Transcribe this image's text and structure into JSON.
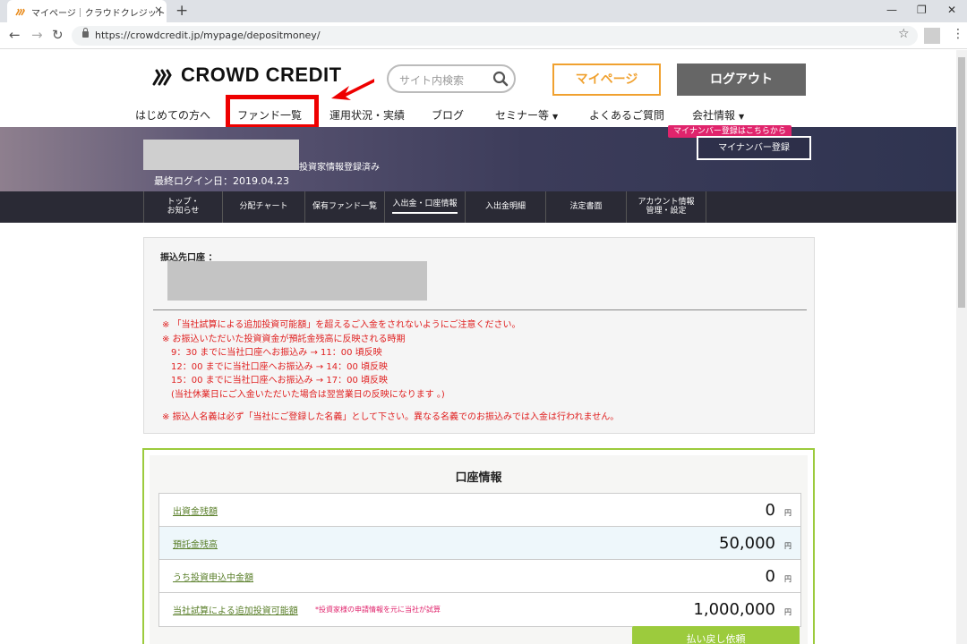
{
  "browser": {
    "tab_title": "マイページ｜クラウドクレジット",
    "url": "https://crowdcredit.jp/mypage/depositmoney/",
    "new_tab": "+",
    "tab_close": "×"
  },
  "header": {
    "logo_text": "CROWD CREDIT",
    "search_placeholder": "サイト内検索",
    "mypage_label": "マイページ",
    "logout_label": "ログアウト"
  },
  "global_nav": {
    "items": [
      {
        "label": "はじめての方へ"
      },
      {
        "label": "ファンド一覧"
      },
      {
        "label": "運用状況・実績"
      },
      {
        "label": "ブログ"
      },
      {
        "label": "セミナー等"
      },
      {
        "label": "よくあるご質問"
      },
      {
        "label": "会社情報"
      }
    ]
  },
  "banner": {
    "status_text": "投資家情報登録済み",
    "last_login": "最終ログイン日：2019.04.23",
    "mynumber_tag": "マイナンバー登録はこちらから",
    "mynumber_button": "マイナンバー登録"
  },
  "subnav": {
    "items": [
      {
        "line1": "トップ・",
        "line2": "お知らせ"
      },
      {
        "line1": "分配チャート",
        "line2": ""
      },
      {
        "line1": "保有ファンド一覧",
        "line2": ""
      },
      {
        "line1": "入出金・口座情報",
        "line2": ""
      },
      {
        "line1": "入出金明細",
        "line2": ""
      },
      {
        "line1": "法定書面",
        "line2": ""
      },
      {
        "line1": "アカウント情報",
        "line2": "管理・設定"
      }
    ]
  },
  "bank": {
    "label": "振込先口座 ：",
    "notes": [
      "※ 「当社試算による追加投資可能額」を超えるご入金をされないようにご注意ください。",
      "※ お振込いただいた投資資金が預託金残高に反映される時期",
      "　9：30 までに当社口座へお振込み → 11：00 頃反映",
      "　12：00 までに当社口座へお振込み → 14：00 頃反映",
      "　15：00 までに当社口座へお振込み → 17：00 頃反映",
      "　(当社休業日にご入金いただいた場合は翌営業日の反映になります 。)",
      "",
      "※ 振込人名義は必ず「当社にご登録した名義」として下さい。異なる名義でのお振込みでは入金は行われません。"
    ]
  },
  "account": {
    "title": "口座情報",
    "unit": "円",
    "rows": [
      {
        "label": "出資金残額",
        "value": "0",
        "note": ""
      },
      {
        "label": "預託金残高",
        "value": "50,000",
        "note": ""
      },
      {
        "label": "うち投資申込中金額",
        "value": "0",
        "note": ""
      },
      {
        "label": "当社試算による追加投資可能額",
        "value": "1,000,000",
        "note": "*投資家様の申請情報を元に当社が試算"
      }
    ],
    "refund_button": "払い戻し依頼"
  }
}
